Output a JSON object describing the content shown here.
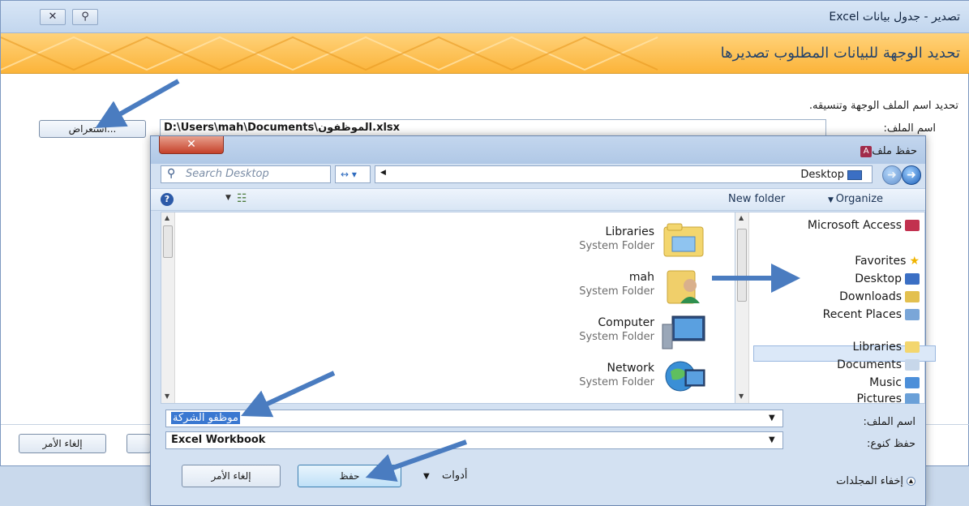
{
  "wizard": {
    "title": "تصدير - جدول بيانات Excel",
    "banner_title": "تحديد الوجهة للبيانات المطلوب تصديرها",
    "instruction": "تحديد اسم الملف الوجهة وتنسيقه.",
    "filename_label": "اسم الملف:",
    "filename_value": "D:\\Users\\mah\\Documents\\الموظفون.xlsx",
    "browse_label": "استعراض...",
    "cancel_label": "إلغاء الأمر",
    "quick_access": [
      "✕",
      "⚲"
    ]
  },
  "dialog": {
    "title": "حفظ ملف",
    "close_label": "✕",
    "search_placeholder": "Search Desktop",
    "address": "Desktop",
    "toolbar": {
      "organize": "Organize",
      "new_folder": "New folder"
    },
    "items": [
      {
        "name": "Libraries",
        "type": "System Folder",
        "icon": "libraries-folder-icon"
      },
      {
        "name": "mah",
        "type": "System Folder",
        "icon": "user-folder-icon"
      },
      {
        "name": "Computer",
        "type": "System Folder",
        "icon": "computer-icon"
      },
      {
        "name": "Network",
        "type": "System Folder",
        "icon": "network-icon"
      }
    ],
    "nav": {
      "microsoft_access": "Microsoft Access",
      "favorites": "Favorites",
      "desktop": "Desktop",
      "downloads": "Downloads",
      "recent_places": "Recent Places",
      "libraries": "Libraries",
      "documents": "Documents",
      "music": "Music",
      "pictures": "Pictures"
    },
    "filename_label": "اسم الملف:",
    "filename_value": "موظفو الشركة",
    "savetype_label": "حفظ كنوع:",
    "savetype_value": "Excel Workbook",
    "hide_folders": "إخفاء المجلدات",
    "tools_label": "أدوات",
    "save_label": "حفظ",
    "cancel_label": "إلغاء الأمر"
  },
  "colors": {
    "banner": "#fbb43a",
    "selection": "#3a78d1",
    "arrow": "#4a7cc0"
  }
}
